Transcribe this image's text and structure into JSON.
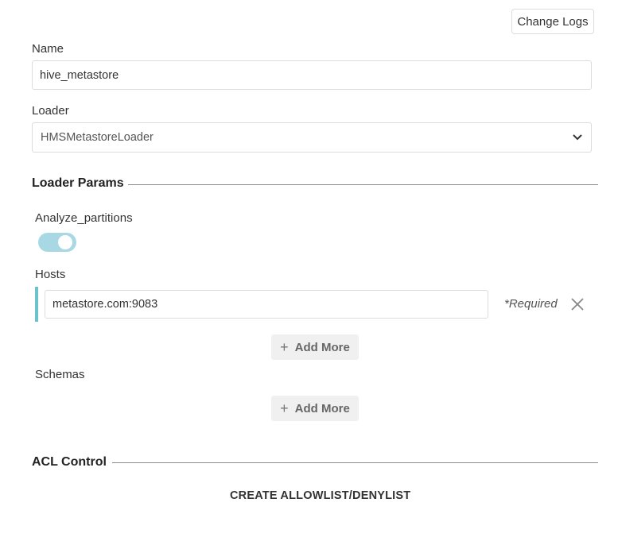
{
  "header": {
    "change_logs_label": "Change Logs"
  },
  "form": {
    "name": {
      "label": "Name",
      "value": "hive_metastore"
    },
    "loader": {
      "label": "Loader",
      "selected": "HMSMetastoreLoader"
    }
  },
  "loader_params": {
    "title": "Loader Params",
    "analyze_partitions": {
      "label": "Analyze_partitions",
      "enabled": true
    },
    "hosts": {
      "label": "Hosts",
      "items": [
        {
          "value": "metastore.com:9083",
          "required_label": "*Required"
        }
      ],
      "add_more_label": "Add More"
    },
    "schemas": {
      "label": "Schemas",
      "add_more_label": "Add More"
    }
  },
  "acl_control": {
    "title": "ACL Control",
    "create_label": "CREATE ALLOWLIST/DENYLIST"
  },
  "colors": {
    "toggle_on": "#a8d8e4",
    "accent_bar": "#6bc3cd"
  },
  "icons": [
    "chevron-down-icon",
    "close-icon",
    "plus-icon"
  ]
}
